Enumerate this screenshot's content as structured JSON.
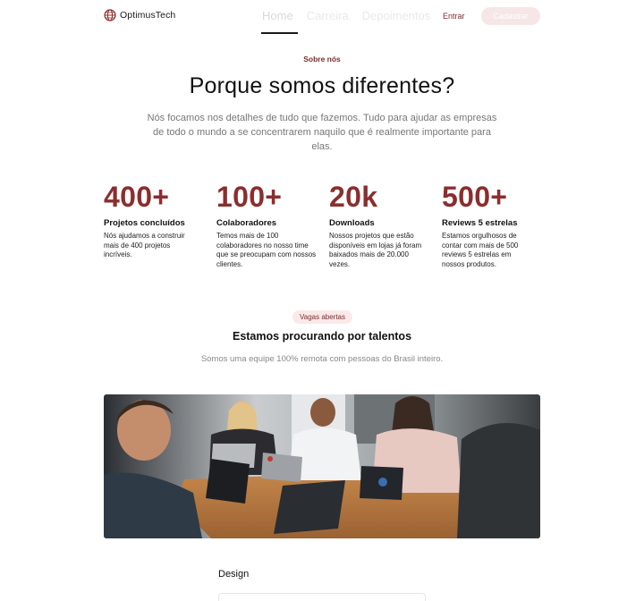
{
  "nav": {
    "brand": "OptimusTech",
    "brand_icon": "globe-icon",
    "links": [
      "Home",
      "Carreira",
      "Depoimentos"
    ],
    "active_link": "Home",
    "login_label": "Entrar",
    "signup_label": "Cadastrar"
  },
  "about": {
    "eyebrow": "Sobre nós",
    "title": "Porque somos diferentes?",
    "description": "Nós focamos nos detalhes de tudo que fazemos. Tudo para ajudar as empresas de todo o mundo a se concentrarem naquilo que é realmente importante para elas."
  },
  "stats": [
    {
      "value": "400+",
      "title": "Projetos concluídos",
      "desc": "Nós ajudamos a construir mais de 400 projetos incríveis."
    },
    {
      "value": "100+",
      "title": "Colaboradores",
      "desc": "Temos mais de 100 colaboradores no nosso time que se preocupam com nossos clientes."
    },
    {
      "value": "20k",
      "title": "Downloads",
      "desc": "Nossos projetos que estão disponíveis em lojas já foram baixados mais de 20.000 vezes."
    },
    {
      "value": "500+",
      "title": "Reviews 5 estrelas",
      "desc": "Estamos orgulhosos de contar com mais de 500 reviews 5 estrelas em nossos produtos."
    }
  ],
  "careers": {
    "badge": "Vagas abertas",
    "title": "Estamos procurando por talentos",
    "description": "Somos uma equipe 100% remota com pessoas do Brasil inteiro.",
    "photo": "team-photo"
  },
  "jobs": {
    "department": "Design"
  },
  "colors": {
    "accent": "#8b2e2e",
    "accent_soft": "#fbe9e9"
  }
}
